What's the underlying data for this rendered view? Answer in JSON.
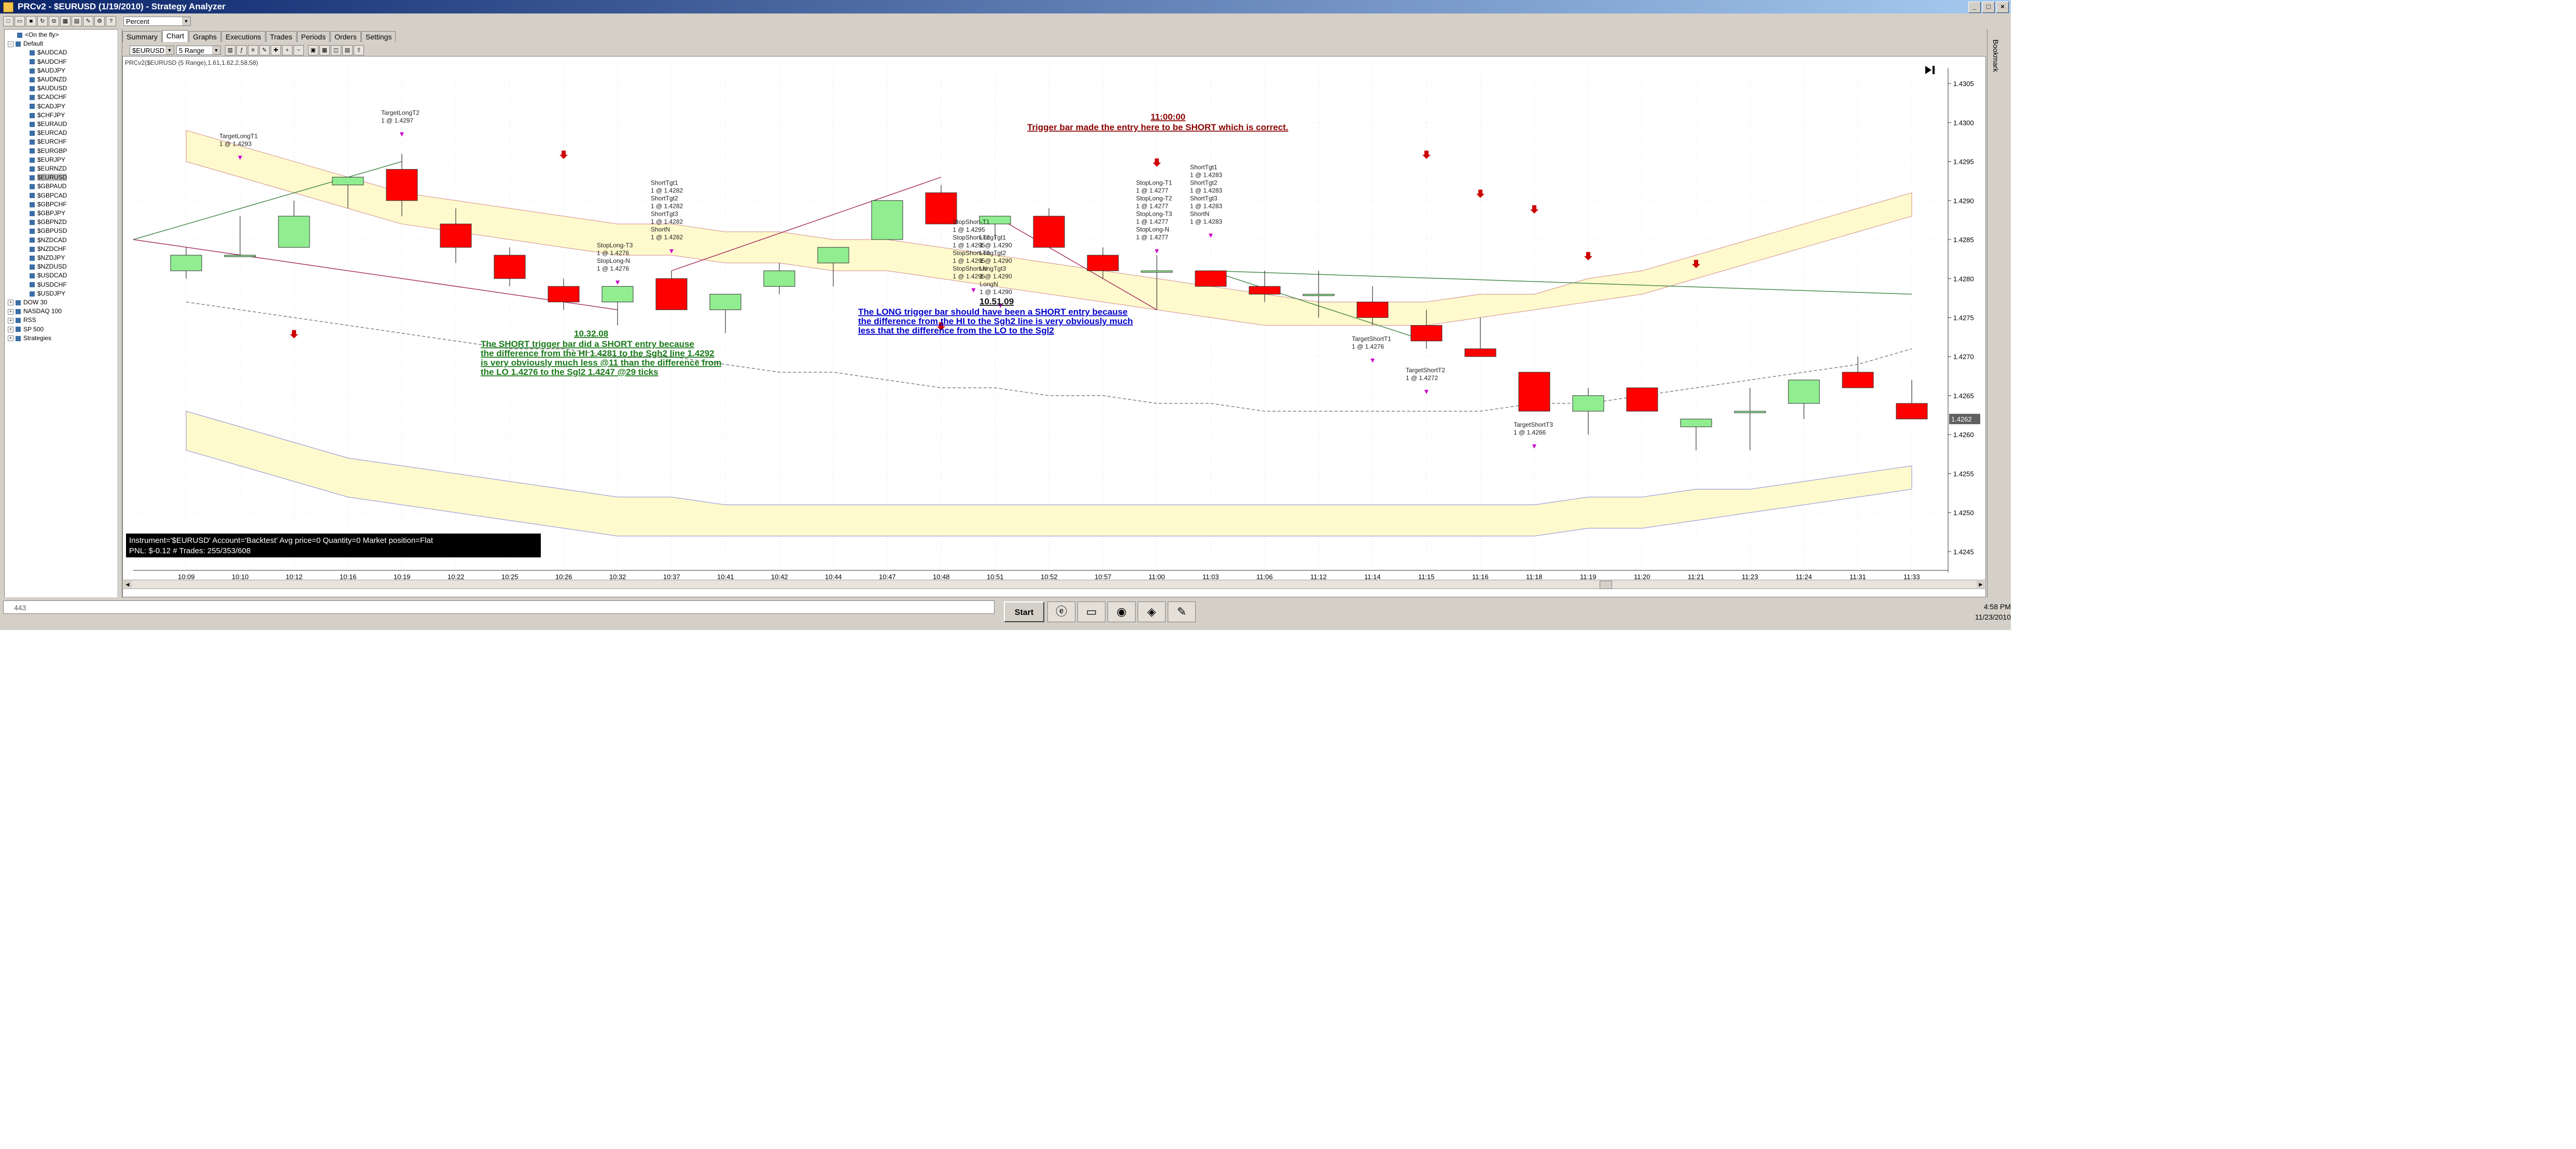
{
  "window": {
    "title": "PRCv2 - $EURUSD (1/19/2010) - Strategy Analyzer",
    "buttons": [
      "_",
      "□",
      "×"
    ]
  },
  "toolbar": {
    "display_mode": "Percent"
  },
  "tree": {
    "root_label": "<On the fly>",
    "default_label": "Default",
    "instruments": [
      "$AUDCAD",
      "$AUDCHF",
      "$AUDJPY",
      "$AUDNZD",
      "$AUDUSD",
      "$CADCHF",
      "$CADJPY",
      "$CHFJPY",
      "$EURAUD",
      "$EURCAD",
      "$EURCHF",
      "$EURGBP",
      "$EURJPY",
      "$EURNZD",
      "$EURUSD",
      "$GBPAUD",
      "$GBPCAD",
      "$GBPCHF",
      "$GBPJPY",
      "$GBPNZD",
      "$GBPUSD",
      "$NZDCAD",
      "$NZDCHF",
      "$NZDJPY",
      "$NZDUSD",
      "$USDCAD",
      "$USDCHF",
      "$USDJPY"
    ],
    "selected": "$EURUSD",
    "groups": [
      "DOW 30",
      "NASDAQ 100",
      "RSS",
      "SP 500",
      "Strategies"
    ]
  },
  "tabs": [
    "Summary",
    "Chart",
    "Graphs",
    "Executions",
    "Trades",
    "Periods",
    "Orders",
    "Settings"
  ],
  "active_tab": "Chart",
  "chart_toolbar": {
    "instrument_combo": "$EURUSD",
    "period_combo": "5 Range"
  },
  "chart": {
    "indicator_label": "PRCv2($EURUSD (5 Range),1.61,1.62,2,58,58)",
    "info_line1": "Instrument='$EURUSD' Account='Backtest' Avg price=0 Quantity=0 Market position=Flat",
    "info_line2": "PNL: $-0.12 # Trades: 255/353/608",
    "last_price": "1.4262",
    "colors": {
      "up": "#90ee90",
      "down": "#ff0000",
      "band": "#fffacd",
      "note_green": "#1a7a1a",
      "note_blue": "#0000cc",
      "note_red": "#8b0000",
      "marker": "#cc00cc"
    }
  },
  "annotations": {
    "short_note_time": "10.32.08",
    "short_note": [
      "The SHORT trigger bar did a SHORT entry because",
      "the difference from the HI 1.4281 to the Sgh2 line 1.4292",
      "is very obviously much less @11 than the difference from",
      "the LO 1.4276 to the Sgl2 1.4247 @29 ticks"
    ],
    "long_note_time": "10.51.09",
    "long_note": [
      "The LONG trigger bar should have been a SHORT entry because",
      "the difference from the HI to the Sgh2 line is very obviously much",
      "less that the difference from the LO to the Sgl2"
    ],
    "top_note_time": "11:00:00",
    "top_note": "Trigger bar made the entry here to be SHORT which is correct.",
    "order_labels": [
      [
        "TargetLongT1",
        "1 @ 1.4293"
      ],
      [
        "TargetLongT2",
        "1 @ 1.4297"
      ],
      [
        "StopLong-T3",
        "1 @ 1.4276",
        "StopLong-N",
        "1 @ 1.4276"
      ],
      [
        "ShortTgt1",
        "1 @ 1.4282",
        "ShortTgt2",
        "1 @ 1.4282",
        "ShortTgt3",
        "1 @ 1.4282",
        "ShortN",
        "1 @ 1.4282"
      ],
      [
        "StopShort-T1",
        "1 @ 1.4295",
        "StopShort-T2",
        "1 @ 1.4295",
        "StopShort-T3",
        "1 @ 1.4295",
        "StopShort-N",
        "1 @ 1.4295"
      ],
      [
        "LongTgt1",
        "1 @ 1.4290",
        "LongTgt2",
        "1 @ 1.4290",
        "LongTgt3",
        "1 @ 1.4290",
        "LongN",
        "1 @ 1.4290"
      ],
      [
        "StopLong-T1",
        "1 @ 1.4277",
        "StopLong-T2",
        "1 @ 1.4277",
        "StopLong-T3",
        "1 @ 1.4277",
        "StopLong-N",
        "1 @ 1.4277"
      ],
      [
        "ShortTgt1",
        "1 @ 1.4283",
        "ShortTgt2",
        "1 @ 1.4283",
        "ShortTgt3",
        "1 @ 1.4283",
        "ShortN",
        "1 @ 1.4283"
      ],
      [
        "TargetShortT1",
        "1 @ 1.4276"
      ],
      [
        "TargetShortT2",
        "1 @ 1.4272"
      ],
      [
        "TargetShortT3",
        "1 @ 1.4266"
      ]
    ]
  },
  "chart_data": {
    "type": "candlestick",
    "y_axis_labels": [
      "1.4305",
      "1.4300",
      "1.4295",
      "1.4290",
      "1.4285",
      "1.4280",
      "1.4275",
      "1.4270",
      "1.4265",
      "1.4260",
      "1.4255",
      "1.4250",
      "1.4245"
    ],
    "ylim": [
      1.4243,
      1.4307
    ],
    "x_labels": [
      "10:09",
      "10:10",
      "10:12",
      "10:16",
      "10:19",
      "10:22",
      "10:25",
      "10:26",
      "10:32",
      "10:37",
      "10:41",
      "10:42",
      "10:44",
      "10:47",
      "10:48",
      "10:51",
      "10:52",
      "10:57",
      "11:00",
      "11:03",
      "11:06",
      "11:12",
      "11:14",
      "11:15",
      "11:16",
      "11:18",
      "11:19",
      "11:20",
      "11:21",
      "11:23",
      "11:24",
      "11:31",
      "11:33"
    ],
    "candles": [
      {
        "o": 1.4281,
        "h": 1.4284,
        "l": 1.428,
        "c": 1.4283
      },
      {
        "o": 1.4283,
        "h": 1.4288,
        "l": 1.4283,
        "c": 1.4283
      },
      {
        "o": 1.4284,
        "h": 1.429,
        "l": 1.4284,
        "c": 1.4288
      },
      {
        "o": 1.4292,
        "h": 1.4293,
        "l": 1.4289,
        "c": 1.4293
      },
      {
        "o": 1.4294,
        "h": 1.4296,
        "l": 1.4288,
        "c": 1.429
      },
      {
        "o": 1.4287,
        "h": 1.4289,
        "l": 1.4282,
        "c": 1.4284
      },
      {
        "o": 1.4283,
        "h": 1.4284,
        "l": 1.4279,
        "c": 1.428
      },
      {
        "o": 1.4279,
        "h": 1.428,
        "l": 1.4276,
        "c": 1.4277
      },
      {
        "o": 1.4277,
        "h": 1.4279,
        "l": 1.4274,
        "c": 1.4279
      },
      {
        "o": 1.428,
        "h": 1.4281,
        "l": 1.4276,
        "c": 1.4276
      },
      {
        "o": 1.4276,
        "h": 1.4278,
        "l": 1.4273,
        "c": 1.4278
      },
      {
        "o": 1.4279,
        "h": 1.4282,
        "l": 1.4278,
        "c": 1.4281
      },
      {
        "o": 1.4282,
        "h": 1.4284,
        "l": 1.4279,
        "c": 1.4284
      },
      {
        "o": 1.4285,
        "h": 1.429,
        "l": 1.4285,
        "c": 1.429
      },
      {
        "o": 1.4291,
        "h": 1.4292,
        "l": 1.4287,
        "c": 1.4287
      },
      {
        "o": 1.4287,
        "h": 1.4287,
        "l": 1.4285,
        "c": 1.4288
      },
      {
        "o": 1.4288,
        "h": 1.4289,
        "l": 1.4284,
        "c": 1.4284
      },
      {
        "o": 1.4283,
        "h": 1.4284,
        "l": 1.428,
        "c": 1.4281
      },
      {
        "o": 1.4281,
        "h": 1.4283,
        "l": 1.4276,
        "c": 1.4281
      },
      {
        "o": 1.4281,
        "h": 1.4281,
        "l": 1.4279,
        "c": 1.4279
      },
      {
        "o": 1.4279,
        "h": 1.4281,
        "l": 1.4277,
        "c": 1.4278
      },
      {
        "o": 1.4278,
        "h": 1.4281,
        "l": 1.4275,
        "c": 1.4278
      },
      {
        "o": 1.4277,
        "h": 1.4279,
        "l": 1.4274,
        "c": 1.4275
      },
      {
        "o": 1.4274,
        "h": 1.4276,
        "l": 1.4271,
        "c": 1.4272
      },
      {
        "o": 1.4271,
        "h": 1.4275,
        "l": 1.427,
        "c": 1.427
      },
      {
        "o": 1.4268,
        "h": 1.4268,
        "l": 1.4263,
        "c": 1.4263
      },
      {
        "o": 1.4263,
        "h": 1.4266,
        "l": 1.426,
        "c": 1.4265
      },
      {
        "o": 1.4266,
        "h": 1.4266,
        "l": 1.4263,
        "c": 1.4263
      },
      {
        "o": 1.4261,
        "h": 1.4262,
        "l": 1.4258,
        "c": 1.4262
      },
      {
        "o": 1.4263,
        "h": 1.4266,
        "l": 1.4258,
        "c": 1.4263
      },
      {
        "o": 1.4264,
        "h": 1.4267,
        "l": 1.4262,
        "c": 1.4267
      },
      {
        "o": 1.4268,
        "h": 1.427,
        "l": 1.4266,
        "c": 1.4266
      },
      {
        "o": 1.4264,
        "h": 1.4267,
        "l": 1.4262,
        "c": 1.4262
      }
    ],
    "upper_band_top": [
      1.4299,
      1.4297,
      1.4295,
      1.4293,
      1.4291,
      1.429,
      1.4289,
      1.4288,
      1.4287,
      1.4287,
      1.4286,
      1.4286,
      1.4285,
      1.4285,
      1.4284,
      1.4283,
      1.4282,
      1.4281,
      1.428,
      1.4279,
      1.4278,
      1.4277,
      1.4277,
      1.4277,
      1.4278,
      1.4278,
      1.428,
      1.4281,
      1.4283,
      1.4285,
      1.4287,
      1.4289,
      1.4291
    ],
    "upper_band_bottom": [
      1.4295,
      1.4293,
      1.4291,
      1.4289,
      1.4287,
      1.4286,
      1.4285,
      1.4284,
      1.4283,
      1.4283,
      1.4282,
      1.4282,
      1.4281,
      1.4281,
      1.428,
      1.4279,
      1.4278,
      1.4277,
      1.4276,
      1.4275,
      1.4274,
      1.4274,
      1.4274,
      1.4274,
      1.4275,
      1.4276,
      1.4277,
      1.4278,
      1.428,
      1.4282,
      1.4284,
      1.4286,
      1.4288
    ],
    "lower_band_top": [
      1.4263,
      1.4261,
      1.4259,
      1.4257,
      1.4256,
      1.4255,
      1.4254,
      1.4253,
      1.4252,
      1.4252,
      1.4251,
      1.4251,
      1.4251,
      1.4251,
      1.4251,
      1.4251,
      1.4251,
      1.4251,
      1.4251,
      1.4251,
      1.4251,
      1.4251,
      1.4251,
      1.4251,
      1.4251,
      1.4251,
      1.4252,
      1.4252,
      1.4253,
      1.4253,
      1.4254,
      1.4255,
      1.4256
    ],
    "lower_band_bottom": [
      1.4258,
      1.4256,
      1.4254,
      1.4252,
      1.4251,
      1.425,
      1.4249,
      1.4248,
      1.4247,
      1.4247,
      1.4247,
      1.4247,
      1.4247,
      1.4247,
      1.4247,
      1.4247,
      1.4247,
      1.4247,
      1.4247,
      1.4247,
      1.4247,
      1.4247,
      1.4247,
      1.4247,
      1.4247,
      1.4247,
      1.4248,
      1.4248,
      1.4249,
      1.425,
      1.4251,
      1.4252,
      1.4253
    ],
    "mid_line": [
      1.4277,
      1.4276,
      1.4275,
      1.4274,
      1.4273,
      1.4272,
      1.4271,
      1.4271,
      1.427,
      1.427,
      1.4269,
      1.4268,
      1.4268,
      1.4267,
      1.4266,
      1.4266,
      1.4265,
      1.4265,
      1.4264,
      1.4264,
      1.4263,
      1.4263,
      1.4263,
      1.4263,
      1.4263,
      1.4264,
      1.4264,
      1.4265,
      1.4266,
      1.4267,
      1.4268,
      1.4269,
      1.4271
    ]
  },
  "taskbar": {
    "cmd_text": "443",
    "start_label": "Start",
    "clock_time": "4:58 PM",
    "clock_date": "11/23/2010"
  },
  "right_strip_label": "Bookmark"
}
